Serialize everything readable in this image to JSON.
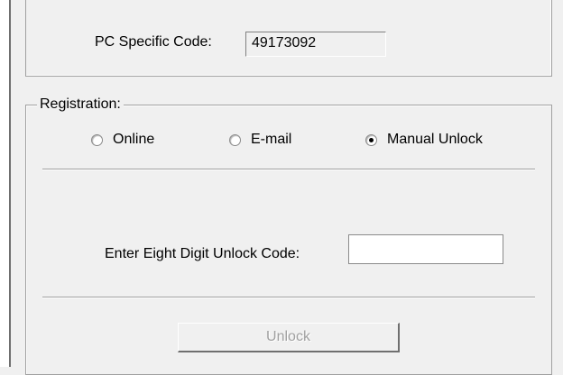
{
  "pc_code": {
    "label": "PC Specific Code:",
    "value": "49173092"
  },
  "registration": {
    "legend": "Registration:",
    "options": [
      {
        "label": "Online",
        "checked": false
      },
      {
        "label": "E-mail",
        "checked": false
      },
      {
        "label": "Manual Unlock",
        "checked": true
      }
    ],
    "unlock_code_label": "Enter Eight Digit Unlock Code:",
    "unlock_code_value": "",
    "unlock_button_label": "Unlock",
    "unlock_button_enabled": false
  }
}
